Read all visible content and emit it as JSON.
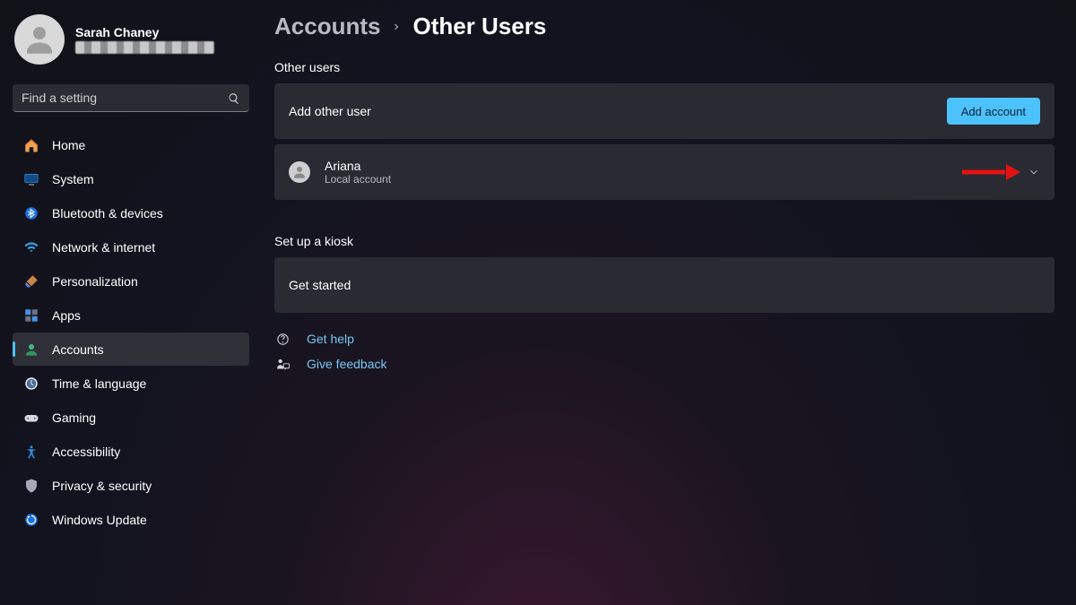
{
  "profile": {
    "name": "Sarah Chaney",
    "email_redacted": true
  },
  "search": {
    "placeholder": "Find a setting"
  },
  "nav": {
    "items": [
      {
        "id": "home",
        "label": "Home"
      },
      {
        "id": "system",
        "label": "System"
      },
      {
        "id": "bluetooth",
        "label": "Bluetooth & devices"
      },
      {
        "id": "network",
        "label": "Network & internet"
      },
      {
        "id": "personalization",
        "label": "Personalization"
      },
      {
        "id": "apps",
        "label": "Apps"
      },
      {
        "id": "accounts",
        "label": "Accounts"
      },
      {
        "id": "time",
        "label": "Time & language"
      },
      {
        "id": "gaming",
        "label": "Gaming"
      },
      {
        "id": "accessibility",
        "label": "Accessibility"
      },
      {
        "id": "privacy",
        "label": "Privacy & security"
      },
      {
        "id": "update",
        "label": "Windows Update"
      }
    ],
    "active_id": "accounts"
  },
  "breadcrumb": {
    "parent": "Accounts",
    "current": "Other Users"
  },
  "sections": {
    "other_users": {
      "title": "Other users",
      "add_label": "Add other user",
      "add_button": "Add account",
      "users": [
        {
          "name": "Ariana",
          "subtitle": "Local account"
        }
      ]
    },
    "kiosk": {
      "title": "Set up a kiosk",
      "cta": "Get started"
    }
  },
  "footer_links": {
    "help": "Get help",
    "feedback": "Give feedback"
  },
  "colors": {
    "accent": "#4cc2ff",
    "link": "#76c7f2",
    "annotation": "#e41111"
  }
}
